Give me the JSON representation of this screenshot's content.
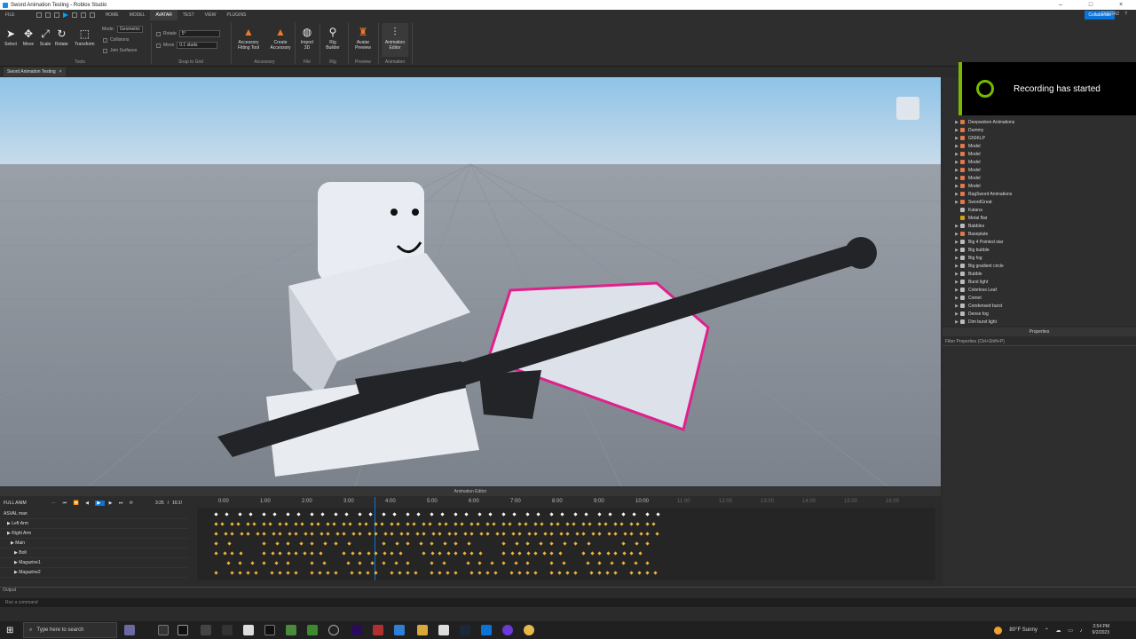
{
  "window": {
    "title": "Sword Animation Testing - Roblox Studio"
  },
  "menu": {
    "tabs": [
      "FILE",
      "HOME",
      "MODEL",
      "AVATAR",
      "TEST",
      "VIEW",
      "PLUGINS"
    ],
    "active_tab": "AVATAR",
    "collaborate": "Collaborate",
    "user": "TYGGRZ"
  },
  "ribbon": {
    "tools": {
      "select": "Select",
      "move": "Move",
      "scale": "Scale",
      "rotate": "Rotate",
      "transform": "Transform"
    },
    "mode_label": "Mode:",
    "mode_value": "Geometric",
    "collisions": "Collisions",
    "join_surfaces": "Join Surfaces",
    "tools_group": "Tools",
    "snap": {
      "rotate_label": "Rotate",
      "rotate_value": "5°",
      "move_label": "Move",
      "move_value": "0.1 studs",
      "group": "Snap to Grid"
    },
    "accessory": {
      "fitting": "Accessory Fitting Tool",
      "create": "Create Accessory",
      "group": "Accessory"
    },
    "file": {
      "import": "Import 3D",
      "group": "File"
    },
    "rig": {
      "builder": "Rig Builder",
      "group": "Rig"
    },
    "preview": {
      "avatar": "Avatar Preview",
      "group": "Preview"
    },
    "animation": {
      "editor": "Animation Editor",
      "group": "Animation"
    }
  },
  "doc_tab": {
    "label": "Sword Animation Testing",
    "close": "×"
  },
  "toast": {
    "text": "Recording has started"
  },
  "explorer": {
    "items": [
      {
        "label": "Deepwoken Animations",
        "arrow": true,
        "color": "#e0784a"
      },
      {
        "label": "Dummy",
        "arrow": true,
        "color": "#e0784a"
      },
      {
        "label": "G50KLP",
        "arrow": true,
        "color": "#e0784a"
      },
      {
        "label": "Model",
        "arrow": true,
        "color": "#e0784a"
      },
      {
        "label": "Model",
        "arrow": true,
        "color": "#e0784a"
      },
      {
        "label": "Model",
        "arrow": true,
        "color": "#e0784a"
      },
      {
        "label": "Model",
        "arrow": true,
        "color": "#e0784a"
      },
      {
        "label": "Model",
        "arrow": true,
        "color": "#e0784a"
      },
      {
        "label": "Model",
        "arrow": true,
        "color": "#e0784a"
      },
      {
        "label": "RagSword Animations",
        "arrow": true,
        "color": "#e0784a"
      },
      {
        "label": "SwordGreat",
        "arrow": true,
        "color": "#e0784a"
      },
      {
        "label": "Katana",
        "arrow": false,
        "color": "#bbbbbb"
      },
      {
        "label": "Metal Bat",
        "arrow": false,
        "color": "#d4a017"
      },
      {
        "label": "Babbles",
        "arrow": true,
        "color": "#bbbbbb"
      },
      {
        "label": "Baseplate",
        "arrow": true,
        "color": "#e0784a"
      },
      {
        "label": "Big 4 Pointed star",
        "arrow": true,
        "color": "#bbbbbb"
      },
      {
        "label": "Big bubble",
        "arrow": true,
        "color": "#bbbbbb"
      },
      {
        "label": "Big fog",
        "arrow": true,
        "color": "#bbbbbb"
      },
      {
        "label": "Big gradient circle",
        "arrow": true,
        "color": "#bbbbbb"
      },
      {
        "label": "Bubble",
        "arrow": true,
        "color": "#bbbbbb"
      },
      {
        "label": "Burst light",
        "arrow": true,
        "color": "#bbbbbb"
      },
      {
        "label": "Colorless Leaf",
        "arrow": true,
        "color": "#bbbbbb"
      },
      {
        "label": "Comet",
        "arrow": true,
        "color": "#bbbbbb"
      },
      {
        "label": "Condensed burst",
        "arrow": true,
        "color": "#bbbbbb"
      },
      {
        "label": "Dense fog",
        "arrow": true,
        "color": "#bbbbbb"
      },
      {
        "label": "Dim burst light",
        "arrow": true,
        "color": "#bbbbbb"
      }
    ]
  },
  "properties": {
    "title": "Properties",
    "filter": "Filter Properties (Ctrl+Shift+P)"
  },
  "animation_editor": {
    "title": "Animation Editor",
    "animation_name": "FULL ANIM",
    "current_time": "3:25",
    "end_time": "16:1!",
    "tracks": [
      "ASVAL man",
      "Left Arm",
      "Right Arm",
      "Main",
      "Bolt",
      "Magazine1",
      "Magazine2"
    ],
    "ruler": [
      "0:00",
      "1:00",
      "2:00",
      "3:00",
      "4:00",
      "5:00",
      "6:00",
      "7:00",
      "8:00",
      "9:00",
      "10:00",
      "11:00",
      "12:00",
      "13:00",
      "14:00",
      "15:00",
      "16:00"
    ]
  },
  "output": {
    "label": "Output",
    "command_placeholder": "Run a command"
  },
  "taskbar": {
    "search": "Type here to search",
    "weather": "80°F  Sunny",
    "time": "2:54 PM",
    "date": "9/2/2023"
  }
}
